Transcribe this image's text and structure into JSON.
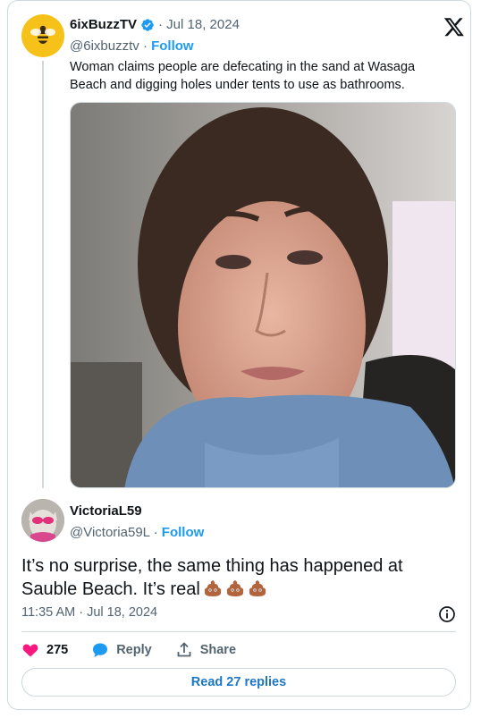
{
  "parent": {
    "name": "6ixBuzzTV",
    "date": "· Jul 18, 2024",
    "handle": "@6ixbuzztv",
    "follow_label": "Follow",
    "text": "Woman claims people are defecating in the sand at Wasaga Beach and digging holes under tents to use as bathrooms."
  },
  "reply": {
    "name": "VictoriaL59",
    "handle": "@Victoria59L",
    "follow_label": "Follow",
    "text": "It’s no surprise, the same thing has happened at Sauble Beach. It’s real",
    "timestamp": "11:35 AM · Jul 18, 2024"
  },
  "actions": {
    "like_count": "275",
    "reply_label": "Reply",
    "share_label": "Share",
    "read_replies_label": "Read 27 replies"
  },
  "colors": {
    "accent": "#1d9bf0",
    "like": "#f91880",
    "text": "#0f1419",
    "muted": "#536471"
  },
  "icons": [
    "x-logo-icon",
    "verified-badge-icon",
    "heart-icon",
    "reply-bubble-icon",
    "share-icon",
    "info-icon",
    "poop-emoji-icon"
  ]
}
